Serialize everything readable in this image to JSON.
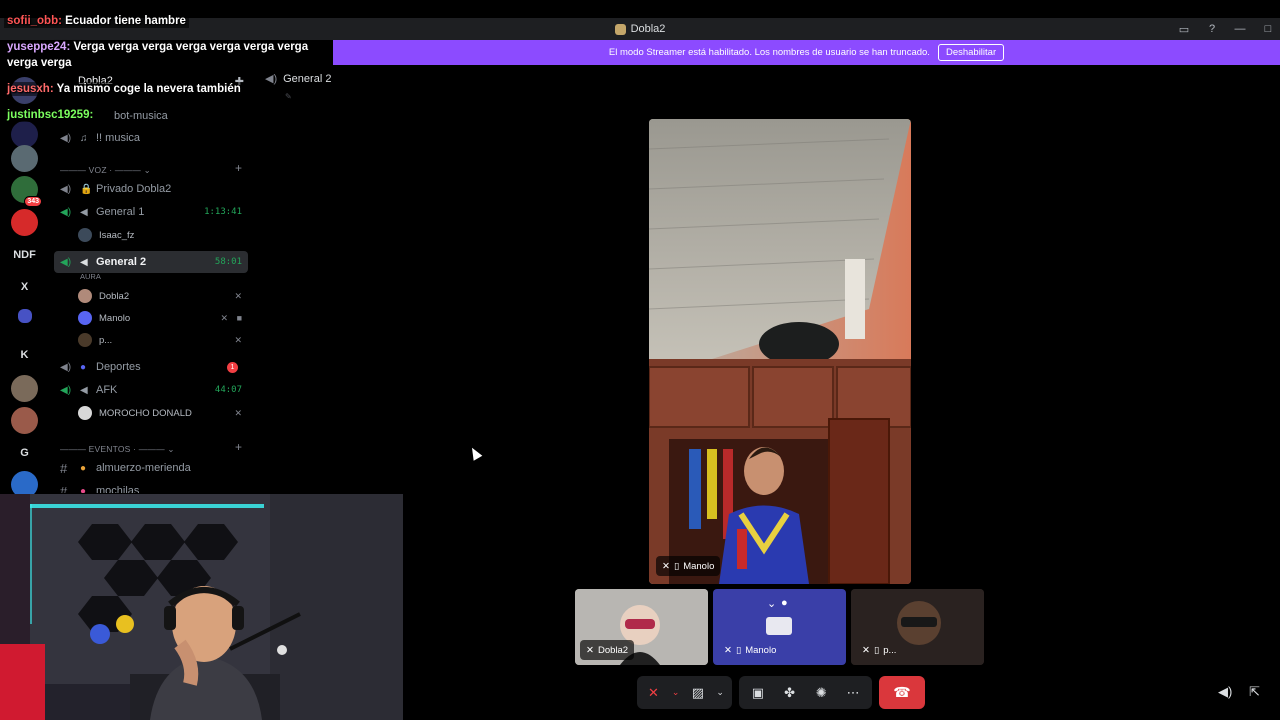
{
  "window": {
    "title": "Dobla2"
  },
  "streamer_banner": {
    "text": "El modo Streamer está habilitado. Los nombres de usuario se han truncado.",
    "button": "Deshabilitar"
  },
  "chat": [
    {
      "user": "sofii_obb:",
      "user_color": "#ff5555",
      "msg": "Ecuador tiene hambre"
    },
    {
      "user": "yuseppe24:",
      "user_color": "#d9a7ff",
      "msg": "Verga verga verga verga verga verga verga"
    },
    {
      "user": "",
      "user_color": "#ffffff",
      "msg": "verga verga"
    },
    {
      "user": "jesusxh:",
      "user_color": "#ff6a6a",
      "msg": "Ya mismo coge la nevera también"
    },
    {
      "user": "justinbsc19259:",
      "user_color": "#7cff5f",
      "msg": ""
    }
  ],
  "servers": [
    {
      "label": "",
      "color": "#3a6b8c"
    },
    {
      "label": "",
      "color": "#6a8c5a"
    },
    {
      "label": "",
      "color": "#2f6d3a",
      "badge": "343"
    },
    {
      "label": "",
      "color": "#d62a2a"
    },
    {
      "label": "NDF",
      "color": "#000000"
    },
    {
      "label": "X",
      "color": "#000000"
    },
    {
      "label": "",
      "color": "#000000"
    },
    {
      "label": "K",
      "color": "#000000"
    },
    {
      "label": "",
      "color": "#7a6a5a"
    },
    {
      "label": "",
      "color": "#9a5a4a"
    },
    {
      "label": "G",
      "color": "#000000"
    },
    {
      "label": "",
      "color": "#2a6ac8"
    }
  ],
  "channels": {
    "server_name": "Dobla2",
    "top_channel": "bot-musica",
    "musica": "!! musica",
    "voice_category": "VOZ",
    "privado": "Privado Dobla2",
    "general1": {
      "name": "General 1",
      "time": "1:13:41"
    },
    "general1_users": [
      "Isaac_fz"
    ],
    "general2": {
      "name": "General 2",
      "time": "58:01",
      "sub": "AURA"
    },
    "general2_users": [
      "Dobla2",
      "Manolo",
      "p..."
    ],
    "deportes": {
      "name": "Deportes",
      "badge": "1"
    },
    "afk": {
      "name": "AFK",
      "time": "44:07"
    },
    "afk_users": [
      "MOROCHO DONALD"
    ],
    "events_category": "EVENTOS",
    "almuerzo": "almuerzo-merienda",
    "mochilas": "mochilas"
  },
  "voice_header": {
    "channel": "General 2"
  },
  "main_video": {
    "name": "Manolo"
  },
  "tiles": [
    {
      "name": "Dobla2"
    },
    {
      "name": "Manolo"
    },
    {
      "name": "p..."
    }
  ]
}
